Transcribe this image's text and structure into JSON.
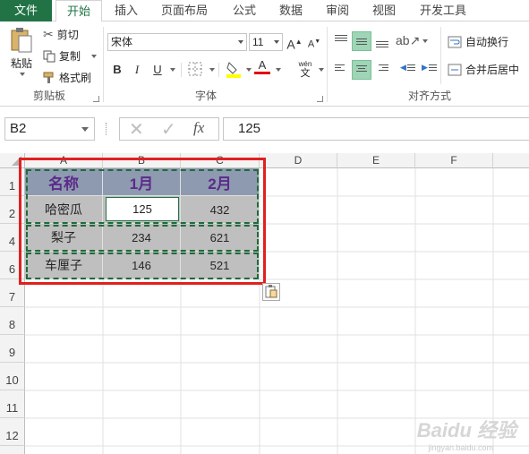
{
  "tabs": [
    {
      "label": "文件"
    },
    {
      "label": "开始"
    },
    {
      "label": "插入"
    },
    {
      "label": "页面布局"
    },
    {
      "label": "公式"
    },
    {
      "label": "数据"
    },
    {
      "label": "审阅"
    },
    {
      "label": "视图"
    },
    {
      "label": "开发工具"
    }
  ],
  "clipboard": {
    "paste_label": "粘贴",
    "cut_label": "剪切",
    "copy_label": "复制",
    "format_painter_label": "格式刷",
    "group_label": "剪贴板"
  },
  "font": {
    "font_name": "宋体",
    "font_size": "11",
    "bold": "B",
    "italic": "I",
    "underline": "U",
    "grow": "A",
    "shrink": "A",
    "font_color_glyph": "A",
    "phonetic_glyph": "wén",
    "phonetic_sub": "文",
    "group_label": "字体"
  },
  "alignment": {
    "wrap_label": "自动换行",
    "merge_label": "合并后居中",
    "group_label": "对齐方式"
  },
  "formula_bar": {
    "name_box": "B2",
    "fx": "fx",
    "formula": "125"
  },
  "columns": [
    "A",
    "B",
    "C",
    "D",
    "E",
    "F"
  ],
  "rows": [
    "1",
    "2",
    "4",
    "6",
    "7",
    "8",
    "9",
    "10",
    "11",
    "12"
  ],
  "table": {
    "header": [
      "名称",
      "1月",
      "2月"
    ],
    "body": [
      [
        "哈密瓜",
        "125",
        "432"
      ],
      [
        "梨子",
        "234",
        "621"
      ],
      [
        "车厘子",
        "146",
        "521"
      ]
    ]
  },
  "watermark": {
    "text": "Baidu 经验",
    "sub": "jingyan.baidu.com"
  },
  "colors": {
    "accent": "#217346",
    "header_fill": "#8e9aaf",
    "header_text": "#5b2b8a",
    "body_fill": "#bfbfbf",
    "highlight_box": "#e02020"
  }
}
